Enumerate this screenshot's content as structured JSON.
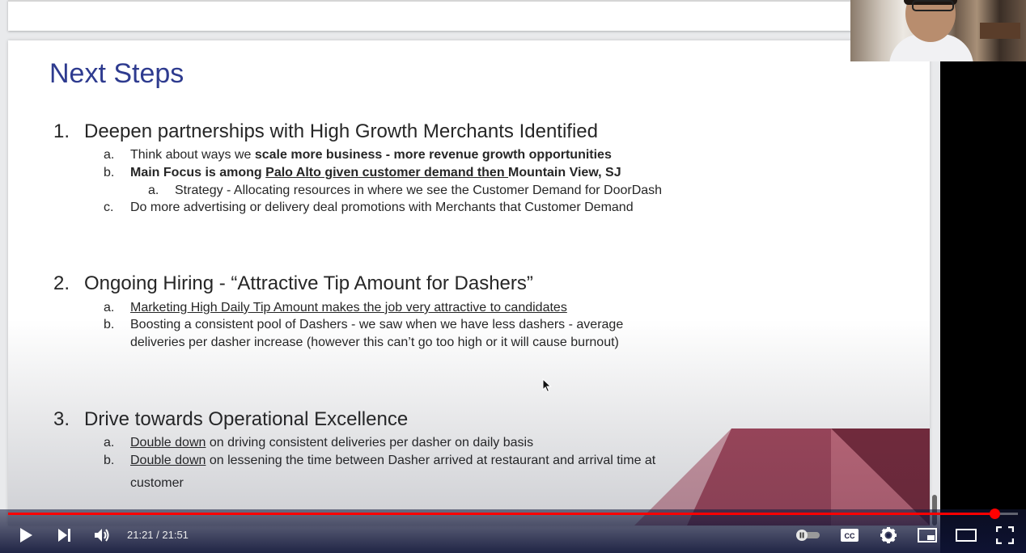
{
  "slide": {
    "title": "Next Steps",
    "sections": [
      {
        "num": "1.",
        "heading": "Deepen partnerships with High Growth Merchants Identified",
        "items": [
          {
            "letter": "a.",
            "pre": "Think about ways we ",
            "bold": "scale more business - more revenue growth opportunities"
          },
          {
            "letter": "b.",
            "bold_pre": "Main Focus is among ",
            "bold_under": "Palo Alto given customer demand then ",
            "bold_post": "Mountain View, SJ"
          },
          {
            "letter": "a.",
            "text": "Strategy - Allocating resources in where we see the Customer Demand for DoorDash"
          },
          {
            "letter": "c.",
            "text": "Do more advertising or delivery deal promotions with Merchants that Customer Demand"
          }
        ]
      },
      {
        "num": "2.",
        "heading": "Ongoing Hiring  - “Attractive Tip Amount for Dashers”",
        "items": [
          {
            "letter": "a.",
            "under": "Marketing High Daily Tip Amount makes the job very attractive to candidates"
          },
          {
            "letter": "b.",
            "text": "Boosting a consistent pool of Dashers -  we saw when we have less dashers - average",
            "cont": "deliveries per dasher increase (however this can’t go too high or it will cause burnout)"
          }
        ]
      },
      {
        "num": "3.",
        "heading": "Drive towards Operational Excellence",
        "items": [
          {
            "letter": "a.",
            "under": "Double down",
            "rest": " on driving consistent deliveries per dasher on daily basis"
          },
          {
            "letter": "b.",
            "under": "Double down",
            "rest": " on lessening the time between Dasher arrived at restaurant and  arrival time at",
            "cont": "customer"
          }
        ]
      }
    ]
  },
  "player": {
    "time": "21:21 / 21:51",
    "progress": 0.977,
    "icons": [
      "play-icon",
      "next-icon",
      "volume-icon",
      "autoplay-toggle-icon",
      "captions-icon",
      "settings-icon",
      "miniplayer-icon",
      "theater-icon",
      "fullscreen-icon"
    ],
    "accent": "#ff0000",
    "captions_label": "CC"
  },
  "colors": {
    "title": "#2e3b8f",
    "deco_dark": "#7a2a3c",
    "deco_mid": "#9c3a50",
    "deco_light": "#c25a6e"
  }
}
